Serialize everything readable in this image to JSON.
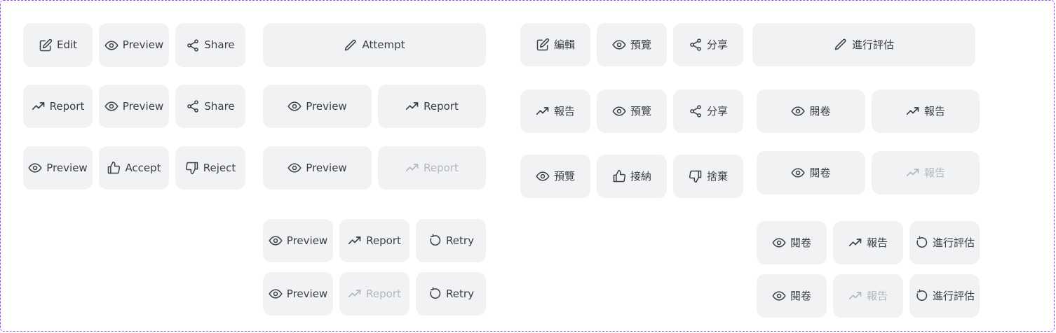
{
  "colors": {
    "button_bg": "#f1f2f4",
    "text": "#3a3d44",
    "disabled_text": "#b3b6bc",
    "frame_border": "#9747ff"
  },
  "en": {
    "edit": "Edit",
    "preview": "Preview",
    "share": "Share",
    "attempt": "Attempt",
    "report": "Report",
    "accept": "Accept",
    "reject": "Reject",
    "retry": "Retry"
  },
  "zh": {
    "edit": "編輯",
    "preview": "預覽",
    "share": "分享",
    "attempt": "進行評估",
    "report": "報告",
    "accept": "接納",
    "reject": "捨棄",
    "review": "閱卷",
    "retry": "進行評估"
  },
  "icons": [
    "edit-icon",
    "eye-icon",
    "share-icon",
    "pencil-icon",
    "trend-icon",
    "thumbs-up-icon",
    "thumbs-down-icon",
    "retry-icon"
  ]
}
